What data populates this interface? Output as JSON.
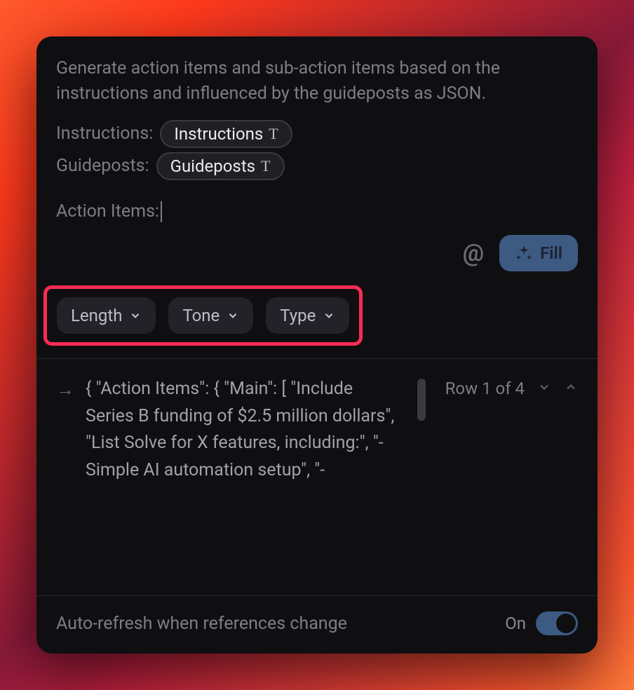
{
  "prompt": {
    "description": "Generate action items and sub-action items based on the instructions and influenced by the guideposts as JSON.",
    "instructions_label": "Instructions:",
    "guideposts_label": "Guideposts:",
    "instructions_chip": "Instructions",
    "guideposts_chip": "Guideposts",
    "action_items_label": "Action Items:"
  },
  "toolbar": {
    "at_label": "@",
    "fill_label": "Fill"
  },
  "dropdowns": {
    "length": "Length",
    "tone": "Tone",
    "type": "Type"
  },
  "result": {
    "json_preview": "{ \"Action Items\": { \"Main\": [ \"Include Series B funding of $2.5 million dollars\", \"List Solve for X features, including:\", \"- Simple AI automation setup\", \"-",
    "pager_label": "Row 1 of 4"
  },
  "footer": {
    "auto_refresh_label": "Auto-refresh when references change",
    "toggle_state": "On"
  },
  "colors": {
    "highlight": "#ff2b55",
    "accent": "#3d5a82"
  }
}
